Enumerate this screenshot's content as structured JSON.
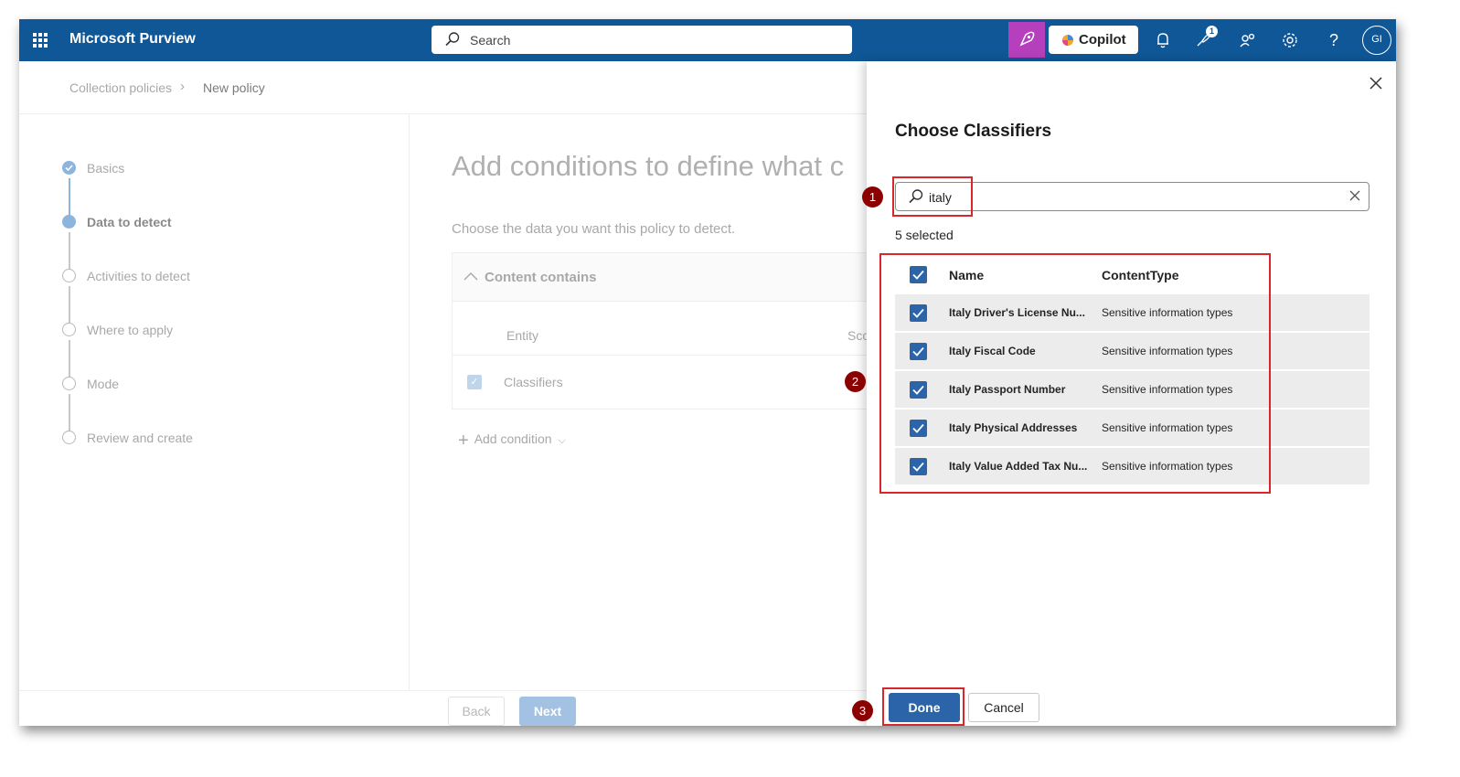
{
  "topbar": {
    "app_name": "Microsoft Purview",
    "search_placeholder": "Search",
    "copilot_label": "Copilot",
    "notification_badge": "1",
    "avatar_initials": "GI"
  },
  "breadcrumb": {
    "parent": "Collection policies",
    "current": "New policy"
  },
  "steps": [
    {
      "label": "Basics",
      "state": "done"
    },
    {
      "label": "Data to detect",
      "state": "current"
    },
    {
      "label": "Activities to detect",
      "state": "todo"
    },
    {
      "label": "Where to apply",
      "state": "todo"
    },
    {
      "label": "Mode",
      "state": "todo"
    },
    {
      "label": "Review and create",
      "state": "todo"
    }
  ],
  "main": {
    "title": "Add conditions to define what c",
    "subtitle": "Choose the data you want this policy to detect.",
    "section_title": "Content contains",
    "col_entity": "Entity",
    "col_scope": "Sco",
    "row_entity": "Classifiers",
    "add_condition": "Add condition"
  },
  "footer": {
    "back": "Back",
    "next": "Next"
  },
  "panel": {
    "title": "Choose Classifiers",
    "search_value": "italy",
    "selected_count": "5 selected",
    "col_name": "Name",
    "col_type": "ContentType",
    "rows": [
      {
        "name": "Italy Driver's License Nu...",
        "type": "Sensitive information types",
        "checked": true
      },
      {
        "name": "Italy Fiscal Code",
        "type": "Sensitive information types",
        "checked": true
      },
      {
        "name": "Italy Passport Number",
        "type": "Sensitive information types",
        "checked": true
      },
      {
        "name": "Italy Physical Addresses",
        "type": "Sensitive information types",
        "checked": true
      },
      {
        "name": "Italy Value Added Tax Nu...",
        "type": "Sensitive information types",
        "checked": true
      }
    ],
    "done": "Done",
    "cancel": "Cancel"
  },
  "annotations": [
    "1",
    "2",
    "3"
  ],
  "colors": {
    "topbar": "#0f5796",
    "accent": "#2b64a8",
    "annotation_red": "#d9262d",
    "annotation_marker": "#8b0000",
    "copilot_button": "#b53fbc"
  }
}
